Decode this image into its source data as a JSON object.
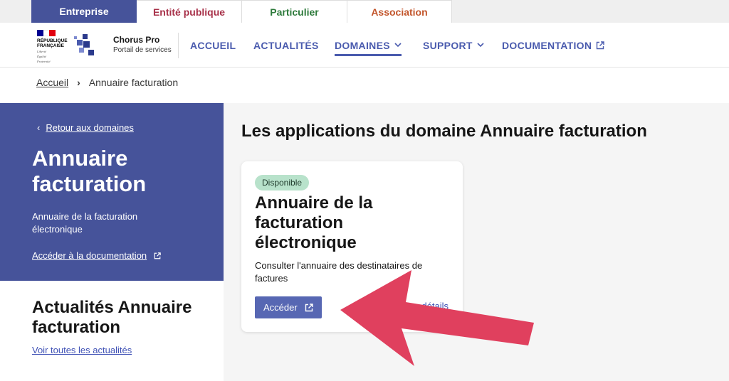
{
  "colors": {
    "accent": "#46539a",
    "nav_text": "#4a5bae",
    "button": "#5767b3",
    "badge_bg": "#b8e2cb",
    "annotation_arrow": "#e0405e"
  },
  "audience_tabs": [
    {
      "label": "Entreprise",
      "color": "#ffffff",
      "active": true
    },
    {
      "label": "Entité publique",
      "color": "#a8324a",
      "active": false
    },
    {
      "label": "Particulier",
      "color": "#2d7a3b",
      "active": false
    },
    {
      "label": "Association",
      "color": "#c2552b",
      "active": false
    }
  ],
  "header": {
    "rf_name_line1": "RÉPUBLIQUE",
    "rf_name_line2": "FRANÇAISE",
    "rf_motto_line1": "Liberté",
    "rf_motto_line2": "Égalité",
    "rf_motto_line3": "Fraternité",
    "brand_name": "Chorus Pro",
    "brand_subtitle": "Portail de services",
    "nav": [
      {
        "label": "ACCUEIL",
        "icon": null,
        "active": false
      },
      {
        "label": "ACTUALITÉS",
        "icon": null,
        "active": false
      },
      {
        "label": "DOMAINES",
        "icon": "chevron-down-icon",
        "active": true
      },
      {
        "label": "SUPPORT",
        "icon": "chevron-down-icon",
        "active": false
      },
      {
        "label": "DOCUMENTATION",
        "icon": "external-link-icon",
        "active": false
      }
    ]
  },
  "breadcrumb": {
    "home": "Accueil",
    "separator": "›",
    "current": "Annuaire facturation"
  },
  "left_panel": {
    "back_icon": "‹",
    "back_label": "Retour aux domaines",
    "title": "Annuaire facturation",
    "description": "Annuaire de la facturation électronique",
    "doc_link": "Accéder à la documentation"
  },
  "news": {
    "title": "Actualités Annuaire facturation",
    "link": "Voir toutes les actualités"
  },
  "main": {
    "title": "Les applications du domaine Annuaire facturation",
    "card": {
      "badge": "Disponible",
      "title": "Annuaire de la facturation électronique",
      "description": "Consulter l'annuaire des destinataires de factures",
      "button_label": "Accéder",
      "details_label": "détails"
    }
  }
}
